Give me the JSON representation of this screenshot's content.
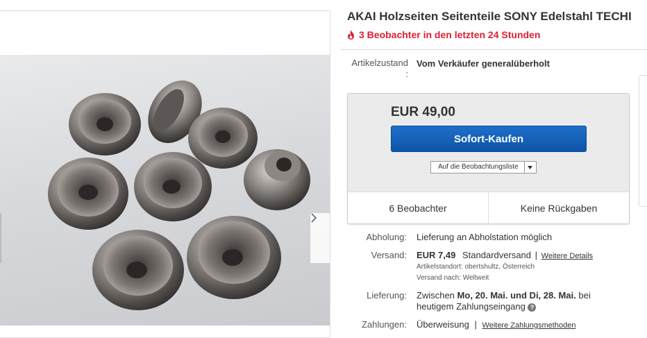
{
  "listing": {
    "title": "AKAI Holzseiten Seitenteile SONY Edelstahl TECHI",
    "watchers_hot": "3 Beobachter in den letzten 24 Stunden",
    "condition_label": "Artikelzustand",
    "condition_colon": ":",
    "condition_value": "Vom Verkäufer generalüberholt"
  },
  "buy_box": {
    "price": "EUR 49,00",
    "buy_now_label": "Sofort-Kaufen",
    "watchlist_label": "Auf die Beobachtungsliste",
    "watchers": "6 Beobachter",
    "returns": "Keine Rückgaben"
  },
  "details": {
    "pickup_label": "Abholung:",
    "pickup_value": "Lieferung an Abholstation möglich",
    "shipping_label": "Versand:",
    "shipping_price": "EUR 7,49",
    "shipping_method": "Standardversand",
    "shipping_sep": "|",
    "shipping_more": "Weitere Details",
    "item_location": "Artikelstandort: obertshultz, Österreich",
    "ships_to": "Versand nach: Weltweit",
    "delivery_label": "Lieferung:",
    "delivery_prefix": "Zwischen",
    "delivery_dates": "Mo, 20. Mai. und Di, 28. Mai.",
    "delivery_suffix": "bei",
    "delivery_line2": "heutigem Zahlungseingang",
    "payment_label": "Zahlungen:",
    "payment_value": "Überweisung",
    "payment_sep": "|",
    "payment_more": "Weitere Zahlungsmethoden"
  },
  "icons": {
    "hot": "flame-icon",
    "next": "chevron-right-icon",
    "dropdown": "caret-down-icon",
    "info": "question-icon"
  },
  "colors": {
    "accent_blue": "#0d54a7",
    "hot_red": "#dd1e31"
  }
}
